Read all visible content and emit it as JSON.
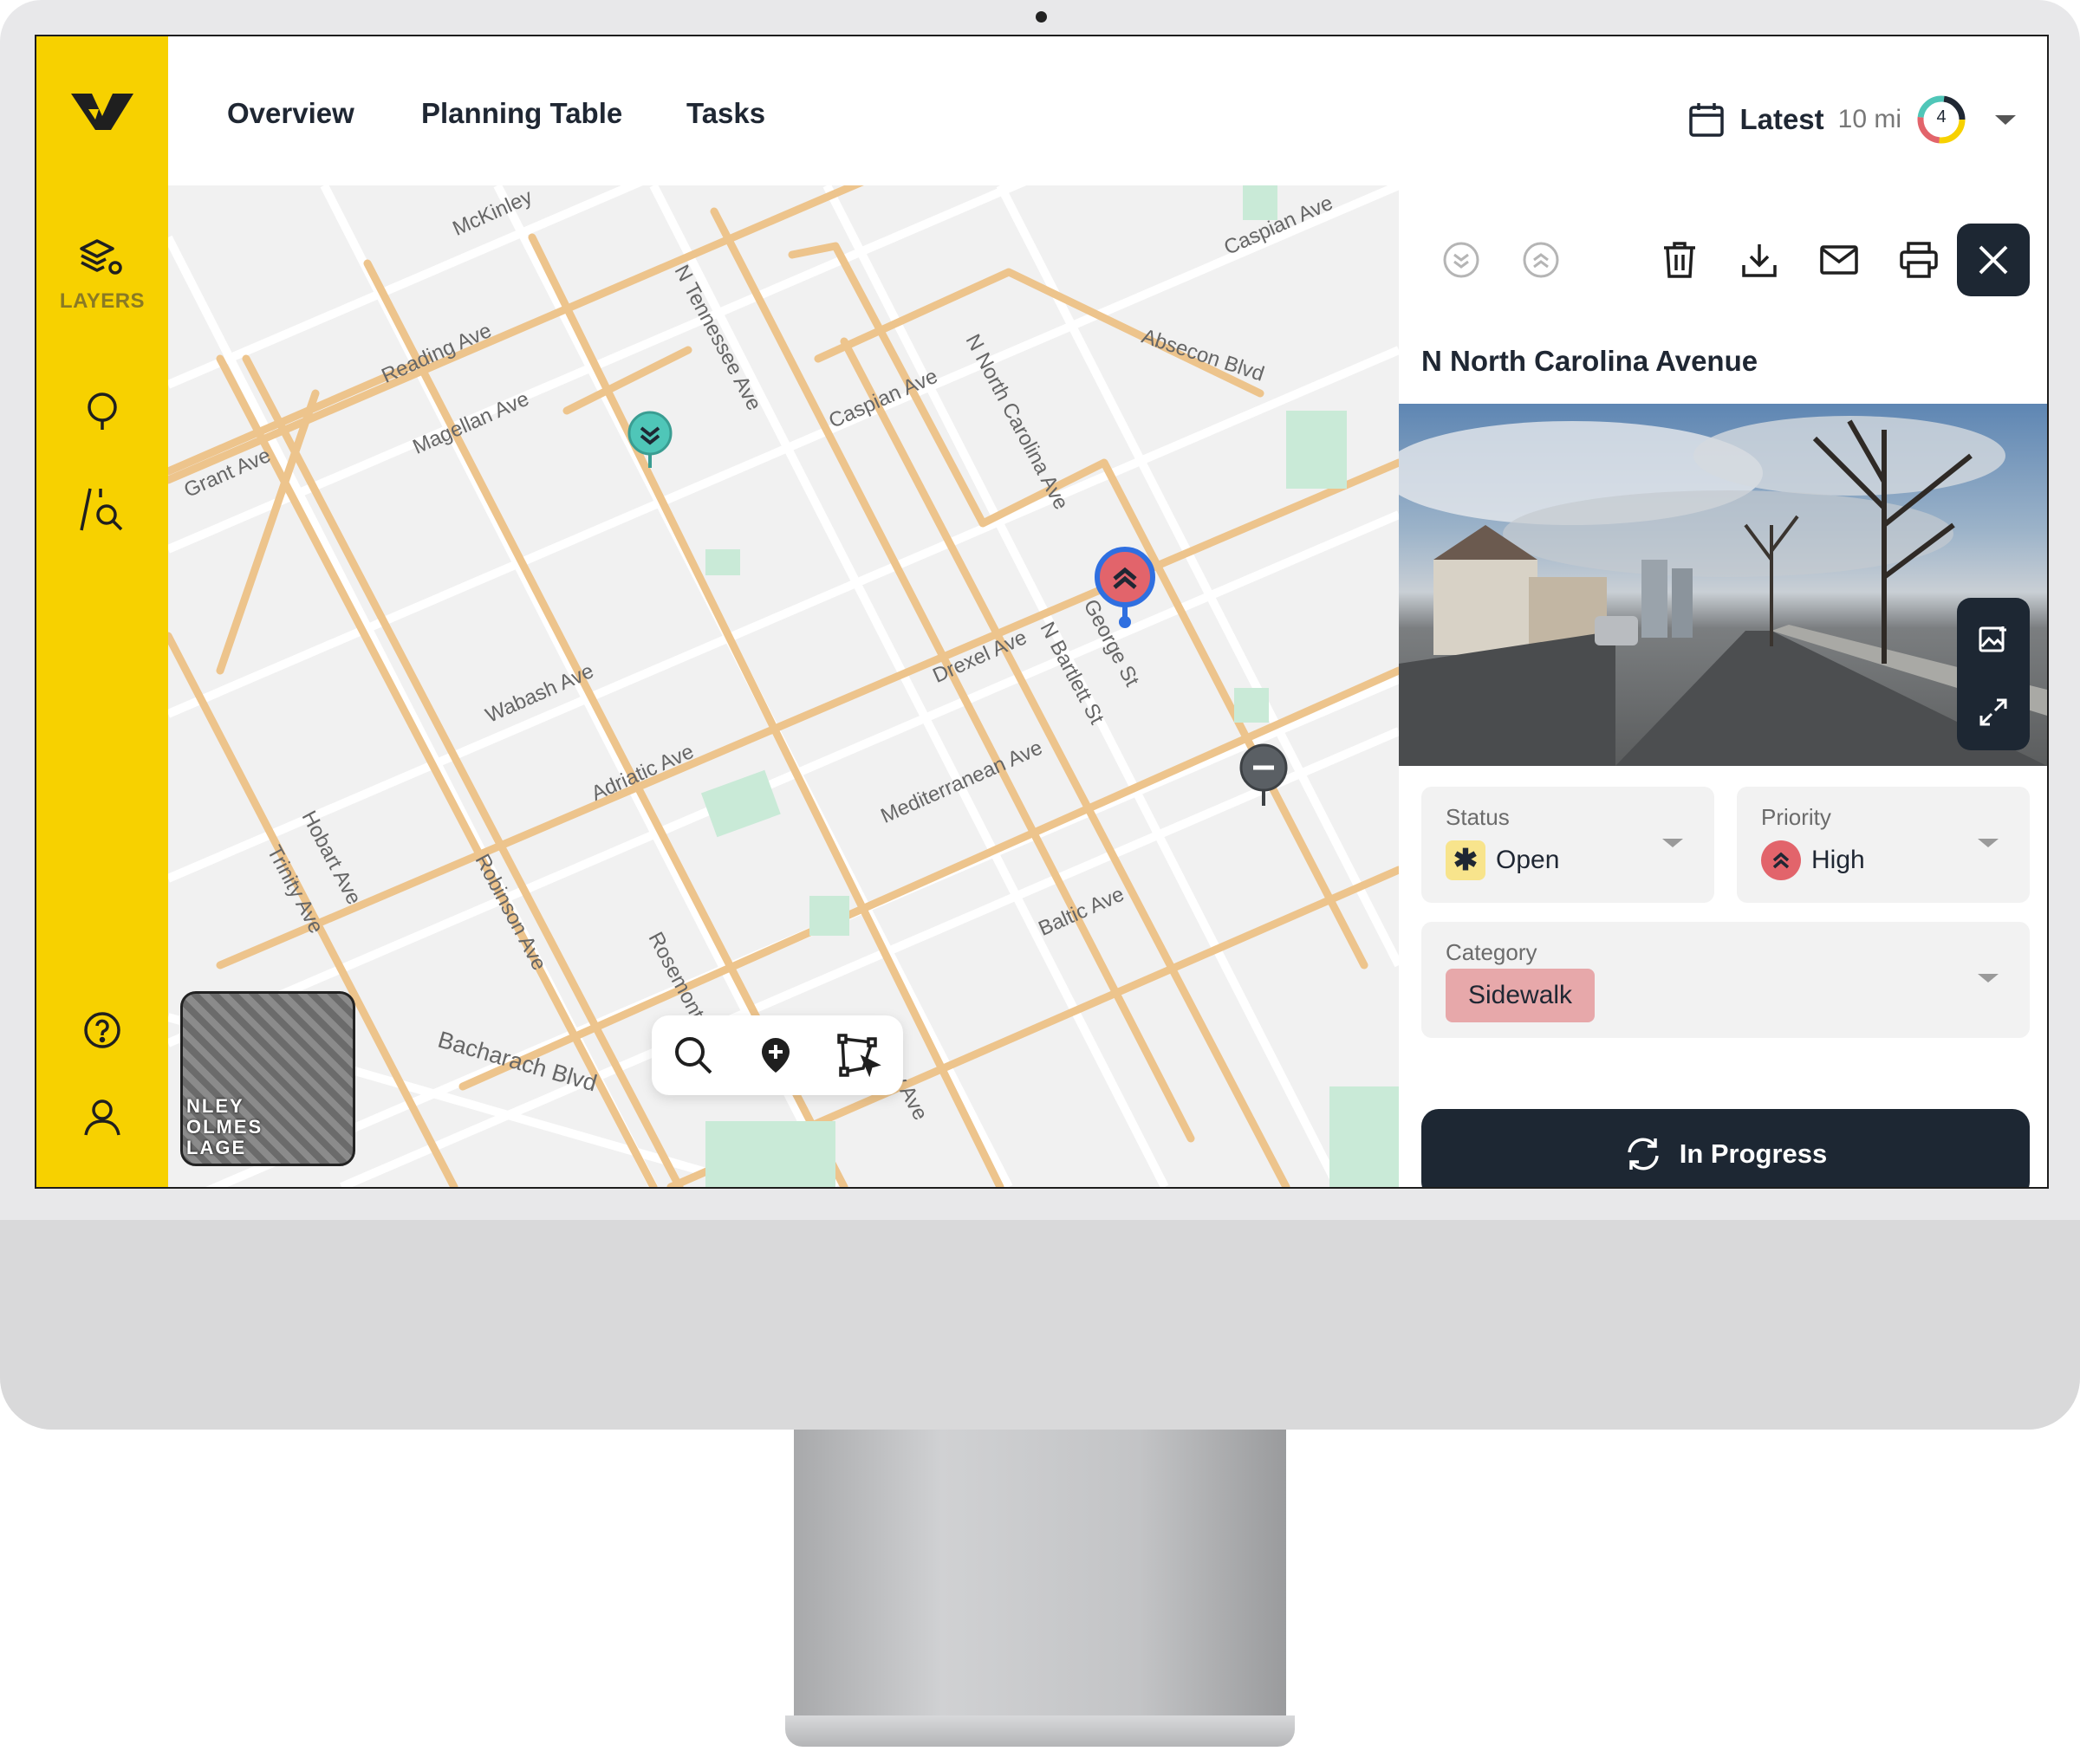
{
  "app": {
    "nav": [
      "Overview",
      "Planning Table",
      "Tasks"
    ],
    "sidebar": {
      "layers_label": "LAYERS"
    },
    "topbar": {
      "latest_label": "Latest",
      "distance": "10 mi",
      "badge_count": "4"
    }
  },
  "map": {
    "street_labels": [
      "McKinley",
      "Reading Ave",
      "Magellan Ave",
      "Grant Ave",
      "N Tennessee Ave",
      "Caspian Ave",
      "Absecon Blvd",
      "Wabash Ave",
      "Adriatic Ave",
      "Robinson Ave",
      "Rosemont Pl",
      "Hobart Ave",
      "Trinity Ave",
      "N Bartlett St",
      "George St",
      "Bay Ave",
      "Baltic Ave",
      "Bacharach Blvd",
      "Mediterranean Ave",
      "N North Carolina Ave",
      "Drexel Ave"
    ],
    "minimap_text": "NLEY\nOLMES\nLAGE"
  },
  "panel": {
    "title": "N North Carolina Avenue",
    "status": {
      "label": "Status",
      "value": "Open"
    },
    "priority": {
      "label": "Priority",
      "value": "High"
    },
    "category": {
      "label": "Category",
      "value": "Sidewalk"
    },
    "action_label": "In Progress"
  },
  "colors": {
    "accent_yellow": "#F7D100",
    "dark": "#1D2733",
    "road_orange": "#EDC48C",
    "priority_high": "#E2646B",
    "marker_blue": "#2F6FE0",
    "marker_teal": "#4FC6B8"
  }
}
